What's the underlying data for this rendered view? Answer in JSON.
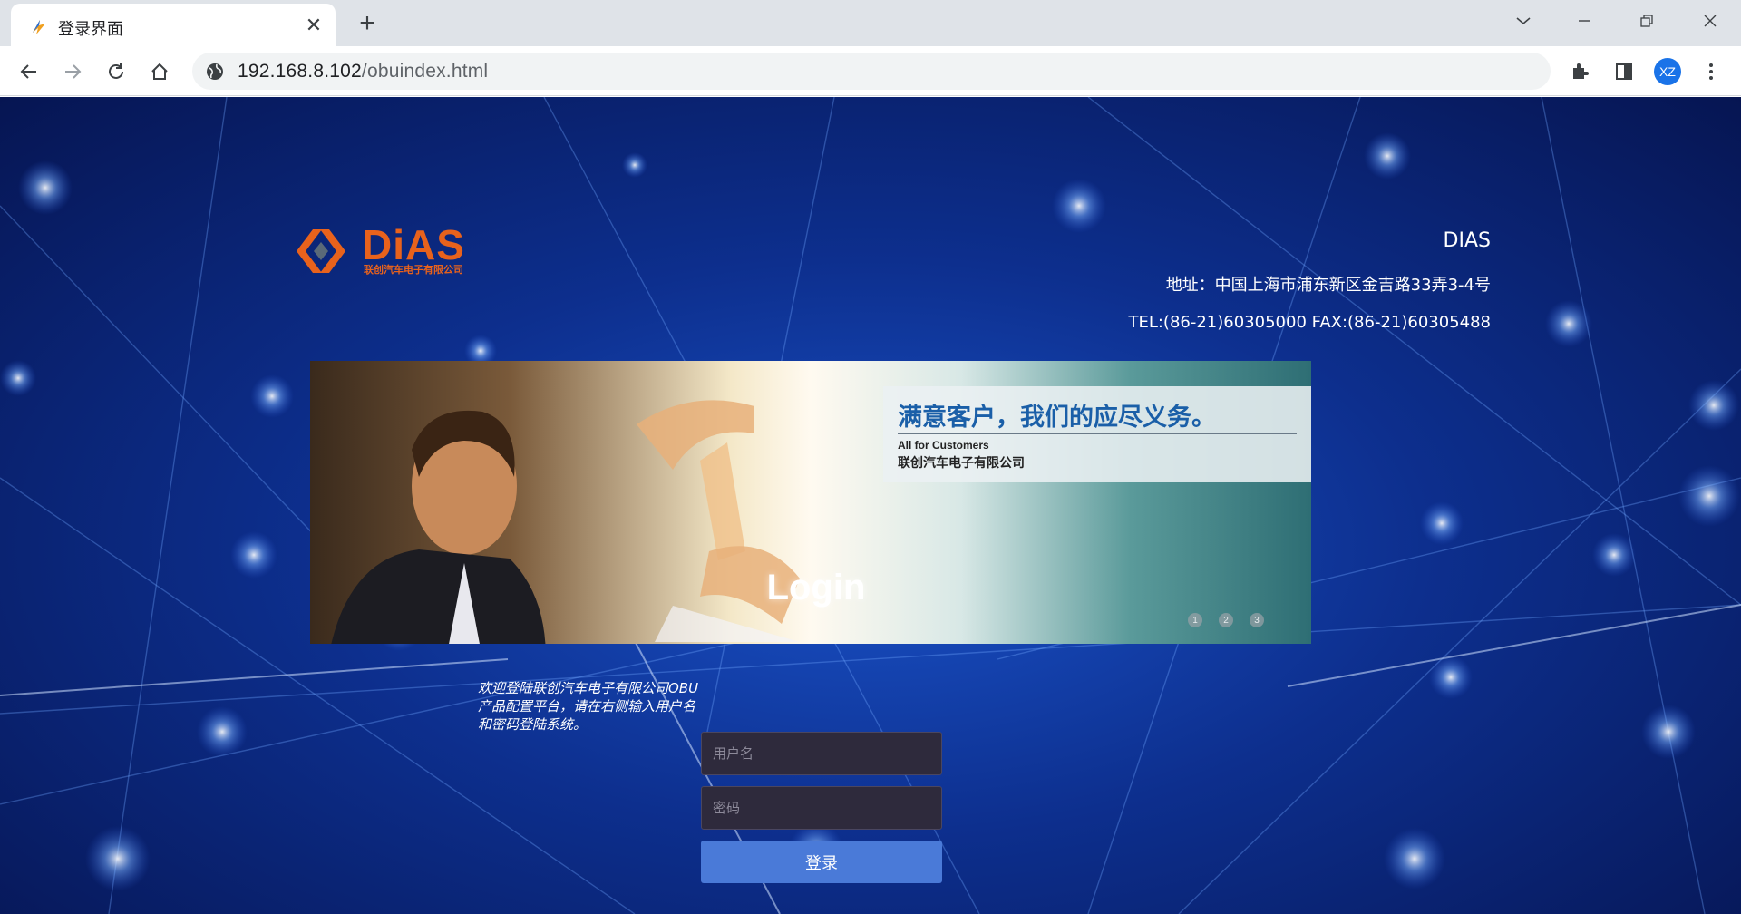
{
  "browser": {
    "tab_title": "登录界面",
    "tab_close": "✕",
    "new_tab": "+",
    "url_host": "192.168.8.102",
    "url_path": "/obuindex.html",
    "profile_initials": "XZ"
  },
  "header": {
    "company_name": "DIAS",
    "address": "地址：中国上海市浦东新区金吉路33弄3-4号",
    "tel_fax": "TEL:(86-21)60305000 FAX:(86-21)60305488",
    "logo_text": "DiAS",
    "logo_subtext": "联创汽车电子有限公司"
  },
  "banner": {
    "headline": "满意客户，我们的应尽义务。",
    "subtitle_en": "All for Customers",
    "subtitle_cn": "联创汽车电子有限公司",
    "dots": [
      "1",
      "2",
      "3"
    ]
  },
  "login": {
    "title": "Login",
    "welcome_text": "欢迎登陆联创汽车电子有限公司OBU产品配置平台，请在右侧输入用户名和密码登陆系统。",
    "username_placeholder": "用户名",
    "password_placeholder": "密码",
    "submit_label": "登录"
  },
  "colors": {
    "accent": "#1a73e8",
    "login_button": "#4a7ad8",
    "logo_orange": "#e8621c",
    "page_bg": "#0d2f8e"
  }
}
